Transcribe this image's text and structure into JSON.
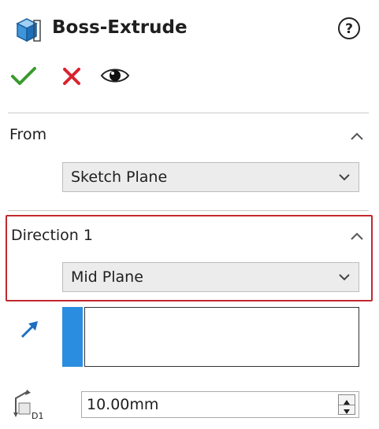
{
  "panel": {
    "title": "Boss-Extrude"
  },
  "icons": {
    "feature": "extrude-feature-icon",
    "help": "help-icon",
    "ok": "checkmark-icon",
    "cancel": "close-icon",
    "preview": "eye-icon",
    "collapse": "chevron-up-icon",
    "dropdown": "chevron-down-icon",
    "direction": "direction-arrow-icon",
    "depth": "depth-d1-icon"
  },
  "colors": {
    "ok_green": "#3a9a2f",
    "cancel_red": "#d9232d",
    "highlight_red": "#c0292f",
    "selection_blue": "#2b8de0"
  },
  "sections": {
    "from": {
      "label": "From",
      "selected": "Sketch Plane"
    },
    "direction1": {
      "label": "Direction 1",
      "selected": "Mid Plane",
      "depth": "10.00mm"
    }
  }
}
